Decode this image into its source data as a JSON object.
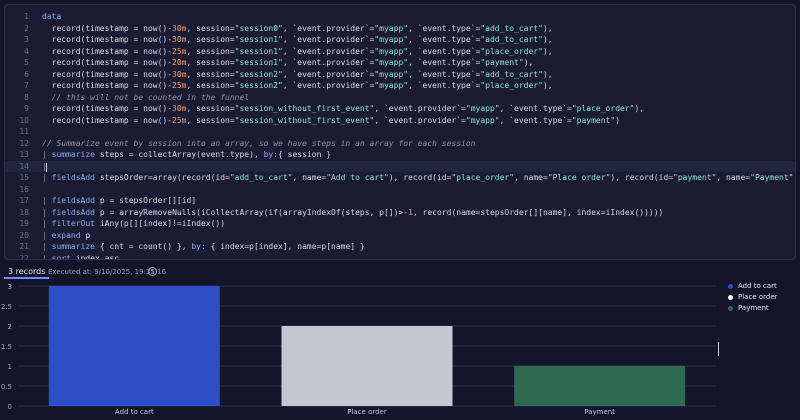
{
  "editor": {
    "lines": [
      {
        "n": "1",
        "segs": [
          [
            "kw",
            "data"
          ]
        ]
      },
      {
        "n": "2",
        "segs": [
          [
            "plain",
            "  record(timestamp = now()-"
          ],
          [
            "num",
            "30m"
          ],
          [
            "plain",
            ", session="
          ],
          [
            "str",
            "\"session0\""
          ],
          [
            "plain",
            ", `event.provider`="
          ],
          [
            "str",
            "\"myapp\""
          ],
          [
            "plain",
            ", `event.type`="
          ],
          [
            "str",
            "\"add_to_cart\""
          ],
          [
            "plain",
            "),"
          ]
        ]
      },
      {
        "n": "3",
        "segs": [
          [
            "plain",
            "  record(timestamp = now()-"
          ],
          [
            "num",
            "30m"
          ],
          [
            "plain",
            ", session="
          ],
          [
            "str",
            "\"session1\""
          ],
          [
            "plain",
            ", `event.provider`="
          ],
          [
            "str",
            "\"myapp\""
          ],
          [
            "plain",
            ", `event.type`="
          ],
          [
            "str",
            "\"add_to_cart\""
          ],
          [
            "plain",
            "),"
          ]
        ]
      },
      {
        "n": "4",
        "segs": [
          [
            "plain",
            "  record(timestamp = now()-"
          ],
          [
            "num",
            "25m"
          ],
          [
            "plain",
            ", session="
          ],
          [
            "str",
            "\"session1\""
          ],
          [
            "plain",
            ", `event.provider`="
          ],
          [
            "str",
            "\"myapp\""
          ],
          [
            "plain",
            ", `event.type`="
          ],
          [
            "str",
            "\"place_order\""
          ],
          [
            "plain",
            "),"
          ]
        ]
      },
      {
        "n": "5",
        "segs": [
          [
            "plain",
            "  record(timestamp = now()-"
          ],
          [
            "num",
            "20m"
          ],
          [
            "plain",
            ", session="
          ],
          [
            "str",
            "\"session1\""
          ],
          [
            "plain",
            ", `event.provider`="
          ],
          [
            "str",
            "\"myapp\""
          ],
          [
            "plain",
            ", `event.type`="
          ],
          [
            "str",
            "\"payment\""
          ],
          [
            "plain",
            "),"
          ]
        ]
      },
      {
        "n": "6",
        "segs": [
          [
            "plain",
            "  record(timestamp = now()-"
          ],
          [
            "num",
            "30m"
          ],
          [
            "plain",
            ", session="
          ],
          [
            "str",
            "\"session2\""
          ],
          [
            "plain",
            ", `event.provider`="
          ],
          [
            "str",
            "\"myapp\""
          ],
          [
            "plain",
            ", `event.type`="
          ],
          [
            "str",
            "\"add_to_cart\""
          ],
          [
            "plain",
            "),"
          ]
        ]
      },
      {
        "n": "7",
        "segs": [
          [
            "plain",
            "  record(timestamp = now()-"
          ],
          [
            "num",
            "25m"
          ],
          [
            "plain",
            ", session="
          ],
          [
            "str",
            "\"session2\""
          ],
          [
            "plain",
            ", `event.provider`="
          ],
          [
            "str",
            "\"myapp\""
          ],
          [
            "plain",
            ", `event.type`="
          ],
          [
            "str",
            "\"place_order\""
          ],
          [
            "plain",
            "),"
          ]
        ]
      },
      {
        "n": "8",
        "segs": [
          [
            "cm",
            "  // this will not be counted in the funnel"
          ]
        ]
      },
      {
        "n": "9",
        "segs": [
          [
            "plain",
            "  record(timestamp = now()-"
          ],
          [
            "num",
            "30m"
          ],
          [
            "plain",
            ", session="
          ],
          [
            "str",
            "\"session_without_first_event\""
          ],
          [
            "plain",
            ", `event.provider`="
          ],
          [
            "str",
            "\"myapp\""
          ],
          [
            "plain",
            ", `event.type`="
          ],
          [
            "str",
            "\"place_order\""
          ],
          [
            "plain",
            "),"
          ]
        ]
      },
      {
        "n": "10",
        "segs": [
          [
            "plain",
            "  record(timestamp = now()-"
          ],
          [
            "num",
            "25m"
          ],
          [
            "plain",
            ", session="
          ],
          [
            "str",
            "\"session_without_first_event\""
          ],
          [
            "plain",
            ", `event.provider`="
          ],
          [
            "str",
            "\"myapp\""
          ],
          [
            "plain",
            ", `event.type`="
          ],
          [
            "str",
            "\"payment\""
          ],
          [
            "plain",
            ")"
          ]
        ]
      },
      {
        "n": "11",
        "segs": []
      },
      {
        "n": "12",
        "segs": [
          [
            "cm",
            "// Summarize event by session into an array, so we have steps in an array for each session"
          ]
        ]
      },
      {
        "n": "13",
        "segs": [
          [
            "pipe",
            "| "
          ],
          [
            "kw",
            "summarize"
          ],
          [
            "plain",
            " steps = collectArray(event.type), "
          ],
          [
            "kw",
            "by:"
          ],
          [
            "plain",
            "{ session }"
          ]
        ]
      },
      {
        "n": "14",
        "segs": [
          [
            "pipe",
            "|"
          ]
        ]
      },
      {
        "n": "15",
        "segs": [
          [
            "pipe",
            "| "
          ],
          [
            "kw",
            "fieldsAdd"
          ],
          [
            "plain",
            " stepsOrder=array(record(id="
          ],
          [
            "str",
            "\"add_to_cart\""
          ],
          [
            "plain",
            ", name="
          ],
          [
            "str",
            "\"Add to cart\""
          ],
          [
            "plain",
            "), record(id="
          ],
          [
            "str",
            "\"place_order\""
          ],
          [
            "plain",
            ", name="
          ],
          [
            "str",
            "\"Place order\""
          ],
          [
            "plain",
            "), record(id="
          ],
          [
            "str",
            "\"payment\""
          ],
          [
            "plain",
            ", name="
          ],
          [
            "str",
            "\"Payment\""
          ],
          [
            "plain",
            "))"
          ]
        ]
      },
      {
        "n": "16",
        "segs": []
      },
      {
        "n": "17",
        "segs": [
          [
            "pipe",
            "| "
          ],
          [
            "kw",
            "fieldsAdd"
          ],
          [
            "plain",
            " p = stepsOrder[][id]"
          ]
        ]
      },
      {
        "n": "18",
        "segs": [
          [
            "pipe",
            "| "
          ],
          [
            "kw",
            "fieldsAdd"
          ],
          [
            "plain",
            " p = arrayRemoveNulls(iCollectArray(if(arrayIndexOf(steps, p[])>-"
          ],
          [
            "num",
            "1"
          ],
          [
            "plain",
            ", record(name=stepsOrder[][name], index=iIndex()))))"
          ]
        ]
      },
      {
        "n": "19",
        "segs": [
          [
            "pipe",
            "| "
          ],
          [
            "kw",
            "filterOut"
          ],
          [
            "plain",
            " iAny(p[][index]!=iIndex())"
          ]
        ]
      },
      {
        "n": "20",
        "segs": [
          [
            "pipe",
            "| "
          ],
          [
            "kw",
            "expand"
          ],
          [
            "plain",
            " p"
          ]
        ]
      },
      {
        "n": "21",
        "segs": [
          [
            "pipe",
            "| "
          ],
          [
            "kw",
            "summarize"
          ],
          [
            "plain",
            " { cnt = count() }, "
          ],
          [
            "kw",
            "by:"
          ],
          [
            "plain",
            " { index=p[index], name=p[name] }"
          ]
        ]
      },
      {
        "n": "22",
        "segs": [
          [
            "pipe",
            "| "
          ],
          [
            "kw",
            "sort"
          ],
          [
            "plain",
            " index asc"
          ]
        ]
      },
      {
        "n": "23",
        "segs": []
      }
    ]
  },
  "results": {
    "records_tab": "3 records",
    "executed": "Executed at: 9/10/2025, 19:35:16",
    "info_icon": "i"
  },
  "colors": {
    "add_to_cart": "#2c4fc7",
    "place_order": "#c6c6d2",
    "payment": "#2e6b52"
  },
  "chart_data": {
    "type": "bar",
    "categories": [
      "Add to cart",
      "Place order",
      "Payment"
    ],
    "values": [
      3,
      2,
      1
    ],
    "ylim": [
      0,
      3
    ],
    "yticks": [
      "0",
      "0.5",
      "1",
      "1.5",
      "2",
      "2.5",
      "3"
    ],
    "grid": true,
    "legend": {
      "placement": "right",
      "entries": [
        "Add to cart",
        "Place order",
        "Payment"
      ]
    }
  }
}
